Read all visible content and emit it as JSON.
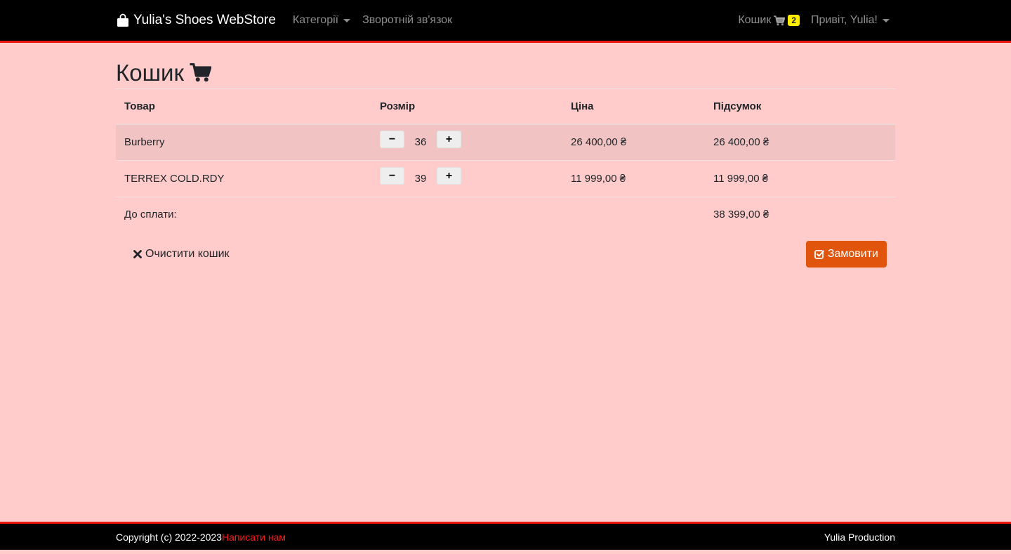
{
  "navbar": {
    "brand": "Yulia's Shoes WebStore",
    "brand_icon": "shopping-bag-icon",
    "categories_label": "Категорії",
    "contact_label": "Зворотній зв'язок",
    "cart_label": "Кошик",
    "cart_icon": "shopping-cart-icon",
    "cart_count": "2",
    "user_label": "Привіт, Yulia!"
  },
  "page": {
    "title": "Кошик",
    "title_icon": "shopping-cart-icon"
  },
  "table": {
    "headers": {
      "product": "Товар",
      "size": "Розмір",
      "price": "Ціна",
      "subtotal": "Підсумок"
    },
    "rows": [
      {
        "product": "Burberry",
        "size": "36",
        "price": "26 400,00 ₴",
        "subtotal": "26 400,00 ₴"
      },
      {
        "product": "TERREX COLD.RDY",
        "size": "39",
        "price": "11 999,00 ₴",
        "subtotal": "11 999,00 ₴"
      }
    ],
    "minus_label": "−",
    "plus_label": "+",
    "total_label": "До сплати:",
    "total_value": "38 399,00 ₴"
  },
  "actions": {
    "clear_label": "Очистити кошик",
    "clear_icon": "close-icon",
    "order_label": "Замовити",
    "order_icon": "check-square-icon"
  },
  "footer": {
    "copyright": "Copyright (c) 2022-2023",
    "write_us": "Написати нам",
    "production": "Yulia Production"
  },
  "colors": {
    "page_background": "#ffcccb",
    "navbar_background": "#000000",
    "accent_border": "#e8160c",
    "order_button": "#e0540c",
    "cart_badge": "#ffee00",
    "footer_link": "#ff1a1a"
  }
}
